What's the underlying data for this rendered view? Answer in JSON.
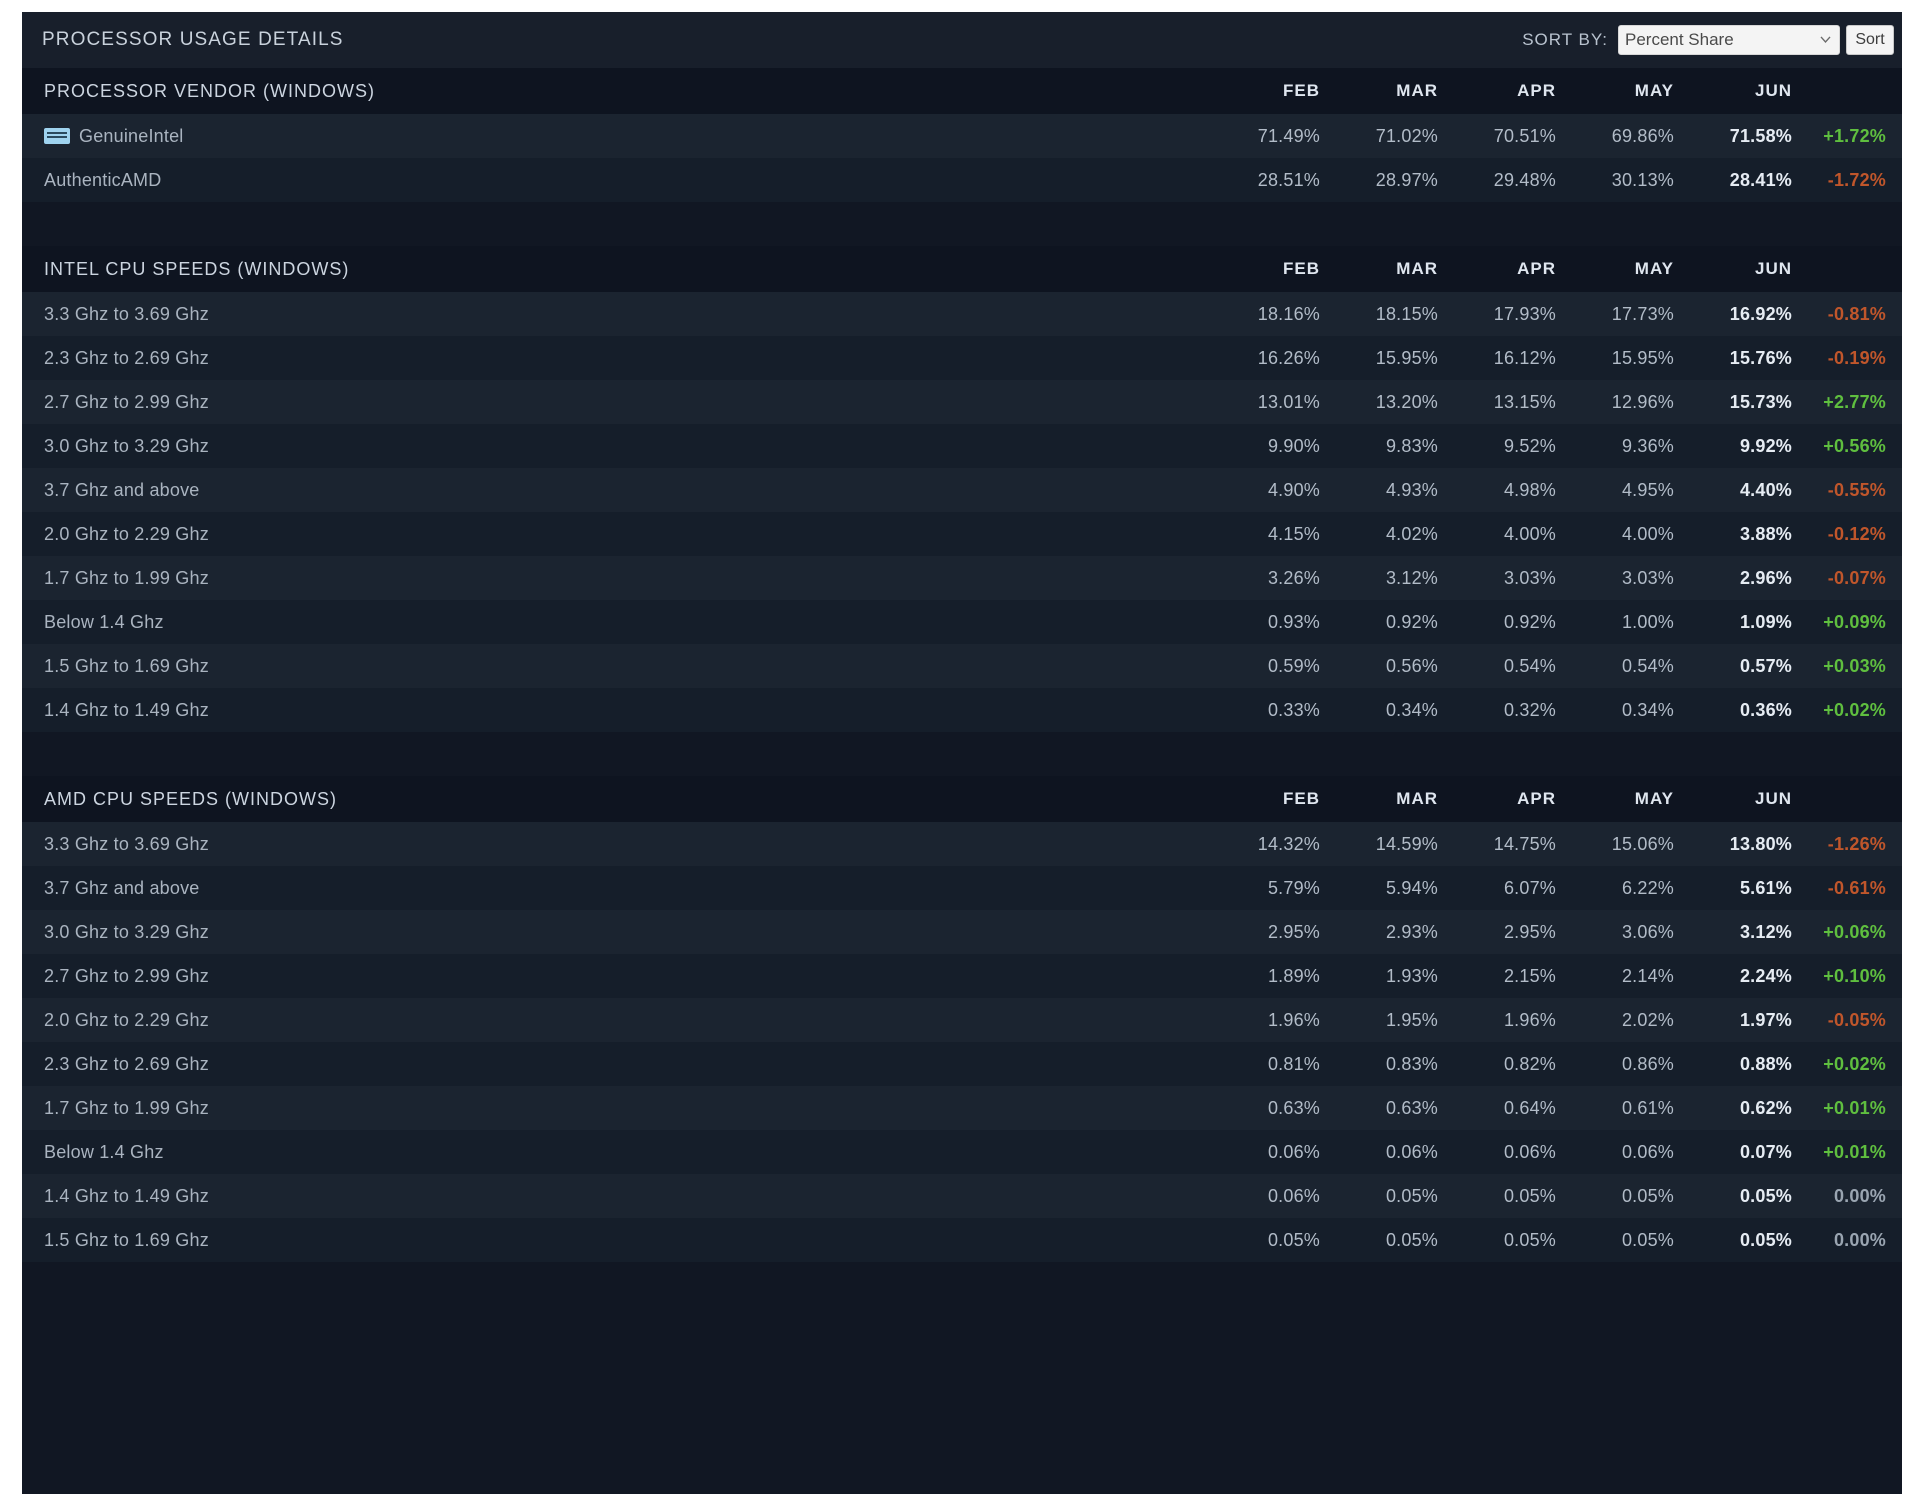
{
  "header": {
    "title": "PROCESSOR USAGE DETAILS",
    "sort_by_label": "SORT BY:",
    "sort_select_value": "Percent Share",
    "sort_button_label": "Sort",
    "chevron_icon": "chevron-down-icon"
  },
  "columns": [
    "FEB",
    "MAR",
    "APR",
    "MAY",
    "JUN"
  ],
  "sections": [
    {
      "title": "PROCESSOR VENDOR (WINDOWS)",
      "rows": [
        {
          "label": "GenuineIntel",
          "icon": "intel-logo-icon",
          "values": [
            "71.49%",
            "71.02%",
            "70.51%",
            "69.86%"
          ],
          "current": "71.58%",
          "change": "+1.72%",
          "dir": "up"
        },
        {
          "label": "AuthenticAMD",
          "icon": "",
          "values": [
            "28.51%",
            "28.97%",
            "29.48%",
            "30.13%"
          ],
          "current": "28.41%",
          "change": "-1.72%",
          "dir": "down"
        }
      ]
    },
    {
      "title": "INTEL CPU SPEEDS (WINDOWS)",
      "rows": [
        {
          "label": "3.3 Ghz to 3.69 Ghz",
          "icon": "",
          "values": [
            "18.16%",
            "18.15%",
            "17.93%",
            "17.73%"
          ],
          "current": "16.92%",
          "change": "-0.81%",
          "dir": "down"
        },
        {
          "label": "2.3 Ghz to 2.69 Ghz",
          "icon": "",
          "values": [
            "16.26%",
            "15.95%",
            "16.12%",
            "15.95%"
          ],
          "current": "15.76%",
          "change": "-0.19%",
          "dir": "down"
        },
        {
          "label": "2.7 Ghz to 2.99 Ghz",
          "icon": "",
          "values": [
            "13.01%",
            "13.20%",
            "13.15%",
            "12.96%"
          ],
          "current": "15.73%",
          "change": "+2.77%",
          "dir": "up"
        },
        {
          "label": "3.0 Ghz to 3.29 Ghz",
          "icon": "",
          "values": [
            "9.90%",
            "9.83%",
            "9.52%",
            "9.36%"
          ],
          "current": "9.92%",
          "change": "+0.56%",
          "dir": "up"
        },
        {
          "label": "3.7 Ghz and above",
          "icon": "",
          "values": [
            "4.90%",
            "4.93%",
            "4.98%",
            "4.95%"
          ],
          "current": "4.40%",
          "change": "-0.55%",
          "dir": "down"
        },
        {
          "label": "2.0 Ghz to 2.29 Ghz",
          "icon": "",
          "values": [
            "4.15%",
            "4.02%",
            "4.00%",
            "4.00%"
          ],
          "current": "3.88%",
          "change": "-0.12%",
          "dir": "down"
        },
        {
          "label": "1.7 Ghz to 1.99 Ghz",
          "icon": "",
          "values": [
            "3.26%",
            "3.12%",
            "3.03%",
            "3.03%"
          ],
          "current": "2.96%",
          "change": "-0.07%",
          "dir": "down"
        },
        {
          "label": "Below 1.4 Ghz",
          "icon": "",
          "values": [
            "0.93%",
            "0.92%",
            "0.92%",
            "1.00%"
          ],
          "current": "1.09%",
          "change": "+0.09%",
          "dir": "up"
        },
        {
          "label": "1.5 Ghz to 1.69 Ghz",
          "icon": "",
          "values": [
            "0.59%",
            "0.56%",
            "0.54%",
            "0.54%"
          ],
          "current": "0.57%",
          "change": "+0.03%",
          "dir": "up"
        },
        {
          "label": "1.4 Ghz to 1.49 Ghz",
          "icon": "",
          "values": [
            "0.33%",
            "0.34%",
            "0.32%",
            "0.34%"
          ],
          "current": "0.36%",
          "change": "+0.02%",
          "dir": "up"
        }
      ]
    },
    {
      "title": "AMD CPU SPEEDS (WINDOWS)",
      "rows": [
        {
          "label": "3.3 Ghz to 3.69 Ghz",
          "icon": "",
          "values": [
            "14.32%",
            "14.59%",
            "14.75%",
            "15.06%"
          ],
          "current": "13.80%",
          "change": "-1.26%",
          "dir": "down"
        },
        {
          "label": "3.7 Ghz and above",
          "icon": "",
          "values": [
            "5.79%",
            "5.94%",
            "6.07%",
            "6.22%"
          ],
          "current": "5.61%",
          "change": "-0.61%",
          "dir": "down"
        },
        {
          "label": "3.0 Ghz to 3.29 Ghz",
          "icon": "",
          "values": [
            "2.95%",
            "2.93%",
            "2.95%",
            "3.06%"
          ],
          "current": "3.12%",
          "change": "+0.06%",
          "dir": "up"
        },
        {
          "label": "2.7 Ghz to 2.99 Ghz",
          "icon": "",
          "values": [
            "1.89%",
            "1.93%",
            "2.15%",
            "2.14%"
          ],
          "current": "2.24%",
          "change": "+0.10%",
          "dir": "up"
        },
        {
          "label": "2.0 Ghz to 2.29 Ghz",
          "icon": "",
          "values": [
            "1.96%",
            "1.95%",
            "1.96%",
            "2.02%"
          ],
          "current": "1.97%",
          "change": "-0.05%",
          "dir": "down"
        },
        {
          "label": "2.3 Ghz to 2.69 Ghz",
          "icon": "",
          "values": [
            "0.81%",
            "0.83%",
            "0.82%",
            "0.86%"
          ],
          "current": "0.88%",
          "change": "+0.02%",
          "dir": "up"
        },
        {
          "label": "1.7 Ghz to 1.99 Ghz",
          "icon": "",
          "values": [
            "0.63%",
            "0.63%",
            "0.64%",
            "0.61%"
          ],
          "current": "0.62%",
          "change": "+0.01%",
          "dir": "up"
        },
        {
          "label": "Below 1.4 Ghz",
          "icon": "",
          "values": [
            "0.06%",
            "0.06%",
            "0.06%",
            "0.06%"
          ],
          "current": "0.07%",
          "change": "+0.01%",
          "dir": "up"
        },
        {
          "label": "1.4 Ghz to 1.49 Ghz",
          "icon": "",
          "values": [
            "0.06%",
            "0.05%",
            "0.05%",
            "0.05%"
          ],
          "current": "0.05%",
          "change": "0.00%",
          "dir": "flat"
        },
        {
          "label": "1.5 Ghz to 1.69 Ghz",
          "icon": "",
          "values": [
            "0.05%",
            "0.05%",
            "0.05%",
            "0.05%"
          ],
          "current": "0.05%",
          "change": "0.00%",
          "dir": "flat"
        }
      ]
    }
  ],
  "colors": {
    "panel_bg": "#111723",
    "header_bg": "#181f2b",
    "row_even": "#1b2430",
    "row_odd": "#151e2a",
    "section_header_bg": "#0e1420",
    "up": "#5fbf3f",
    "down": "#c0562b",
    "flat": "#9aa5b1"
  }
}
